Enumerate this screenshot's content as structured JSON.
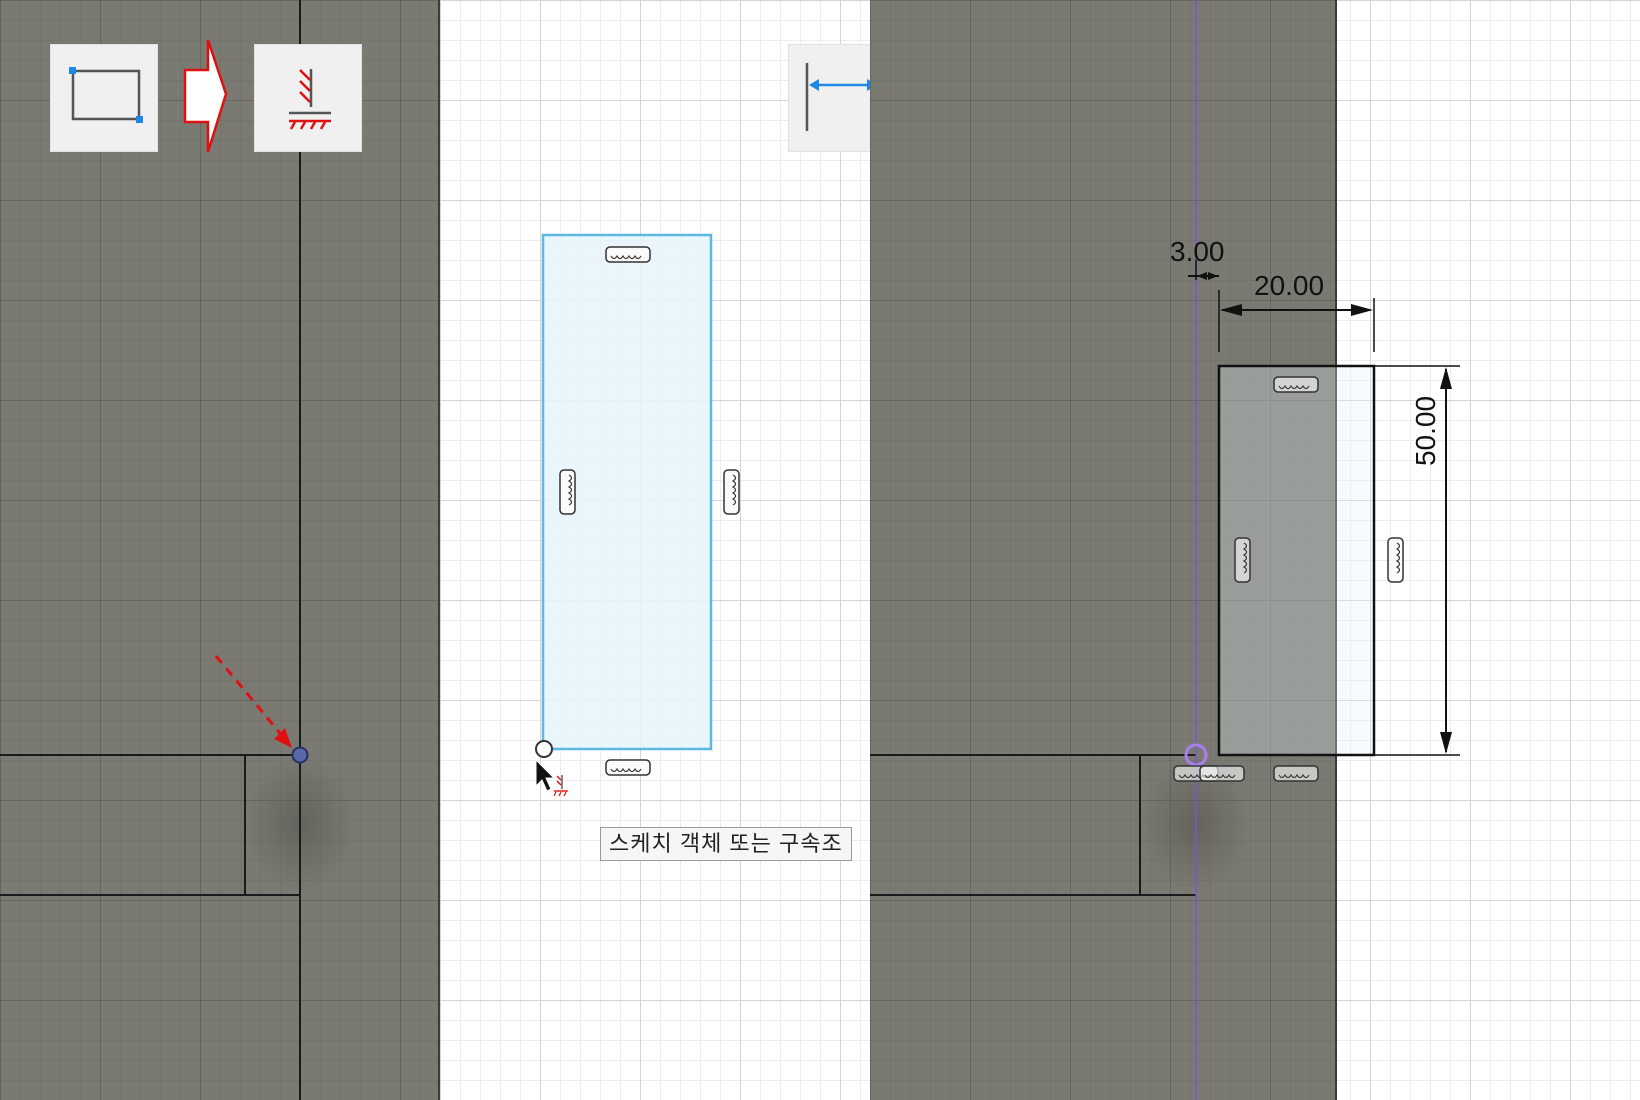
{
  "panels": {
    "left": {
      "tool_icons": [
        "rectangle-tool-icon",
        "arrow-right-icon",
        "fix-constraint-icon"
      ],
      "accent_arrow_color": "#e01010",
      "rectangle_corner_color": "#1e88e5"
    },
    "middle": {
      "tool_icons": [
        "sketch-dimension-icon"
      ],
      "tooltip_text": "스케치 객체 또는 구속조",
      "profile_fill": "#e6f3fb",
      "profile_stroke": "#5fb7e4"
    },
    "right": {
      "dimensions": {
        "offset": "3.00",
        "width": "20.00",
        "height": "50.00"
      },
      "construction_line_color": "#7a55d8"
    }
  }
}
